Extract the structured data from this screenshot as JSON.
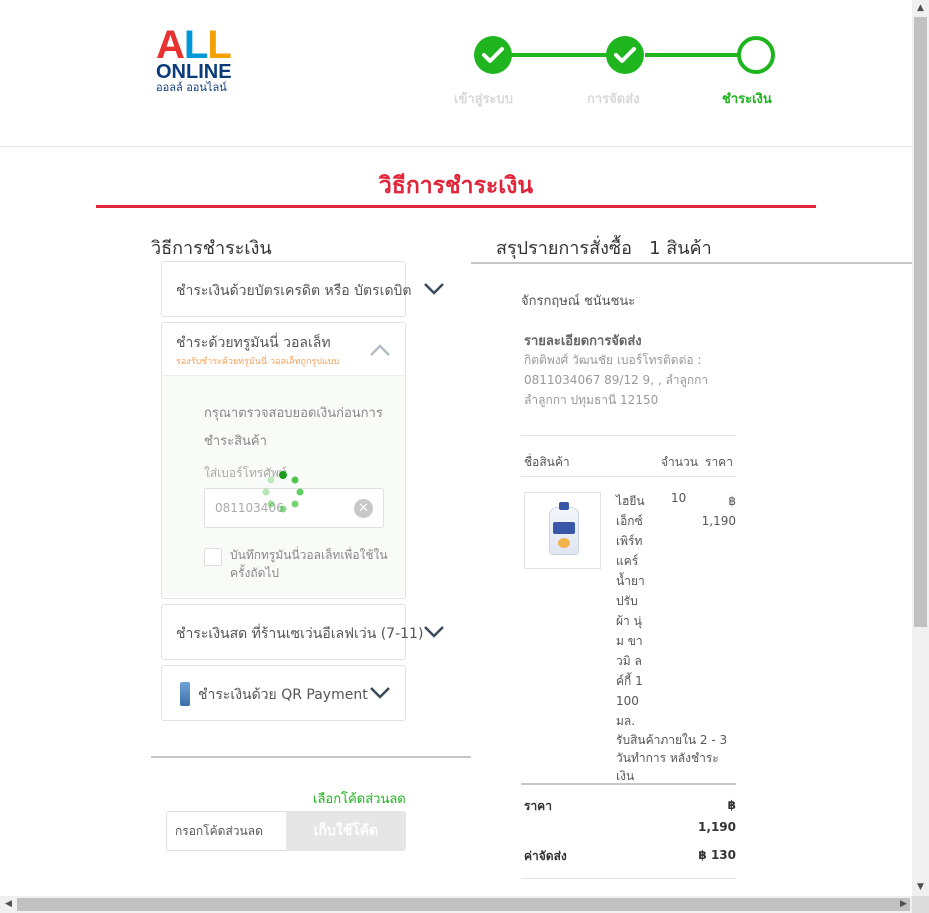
{
  "header": {
    "logo": {
      "word1": "ALL",
      "word2": "ONLINE",
      "thai": "ออลล์ ออนไลน์"
    },
    "steps": [
      {
        "label": "เข้าสู่ระบบ",
        "state": "done"
      },
      {
        "label": "การจัดส่ง",
        "state": "done"
      },
      {
        "label": "ชำระเงิน",
        "state": "active"
      }
    ],
    "accent": "#1fb51f"
  },
  "page_title": "วิธีการชำระเงิน",
  "payment": {
    "heading": "วิธีการชำระเงิน",
    "methods": [
      {
        "title": "ชำระเงินด้วยบัตรเครดิต หรือ บัตรเดบิต",
        "state": "collapsed"
      },
      {
        "title": "ชำระด้วยทรูมันนี่ วอลเล็ท",
        "subtitle": "รองรับชำระด้วยทรูมันนี่ วอลเล็ทถูกรูปแบบ",
        "state": "expanded",
        "check_message": "กรุณาตรวจสอบยอดเงินก่อนการชำระสินค้า",
        "phone_label": "ใส่เบอร์โทรศัพท์",
        "phone_value": "081103406",
        "save_label": "บันทึกทรูมันนี่วอลเล็ทเพื่อใช้ในครั้งถัดไป"
      },
      {
        "title": "ชำระเงินสด ที่ร้านเซเว่นอีเลฟเว่น (7-11)",
        "state": "collapsed"
      },
      {
        "title": "ชำระเงินด้วย QR Payment",
        "state": "collapsed"
      }
    ],
    "coupon": {
      "link": "เลือกโค้ดส่วนลด",
      "placeholder": "กรอกโค้ดส่วนลด",
      "button": "เก็บใช้โค้ด"
    }
  },
  "summary": {
    "heading": "สรุปรายการสั่งซื้อ",
    "count": "1 สินค้า",
    "customer": "จักรกฤษณ์ ชนันชนะ",
    "shipping_heading": "รายละเอียดการจัดส่ง",
    "shipping_text": "กิตติพงศ์ วัฒนชัย เบอร์โทรติดต่อ : 0811034067 89/12 9, , ลำลูกกา ลำลูกกา ปทุมธานี 12150",
    "columns": {
      "name": "ชื่อสินค้า",
      "qty": "จำนวน",
      "price": "ราคา"
    },
    "item": {
      "name": "ไฮยีน เอ็กซ์ เพิร์ท แคร์ น้ำยา ปรับ ผ้า นุ่ม ขาวมิ ลค์กี้ 1100 มล.",
      "qty": "10",
      "currency": "฿",
      "price": "1,190",
      "delivery_note": "รับสินค้าภายใน 2 - 3 วันทำการ หลังชำระเงิน"
    },
    "totals": {
      "price_label": "ราคา",
      "price_currency": "฿",
      "price_value": "1,190",
      "shipping_label": "ค่าจัดส่ง",
      "shipping_value": "฿ 130"
    }
  }
}
